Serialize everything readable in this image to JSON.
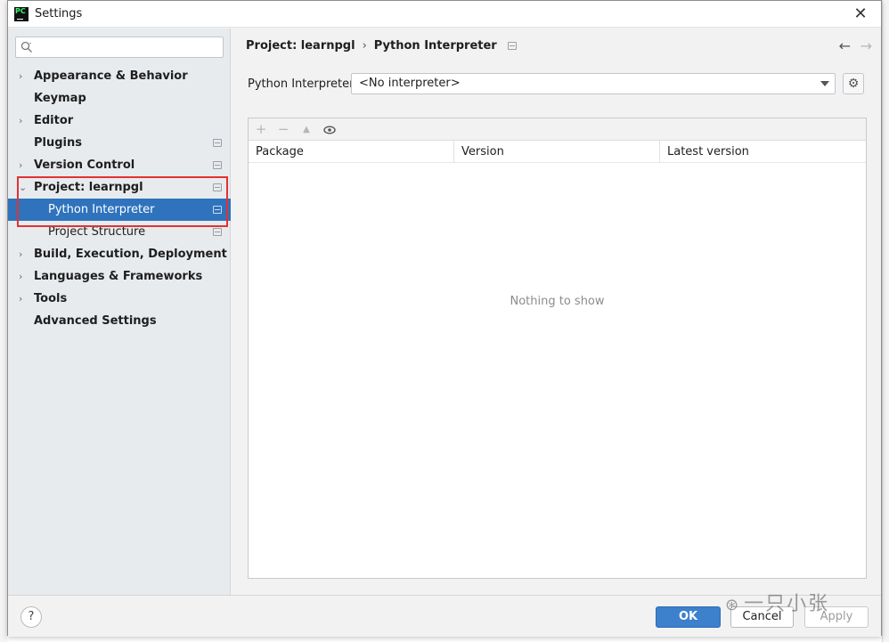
{
  "window": {
    "title": "Settings",
    "app_icon": "pycharm-logo"
  },
  "search": {
    "placeholder": ""
  },
  "sidebar": {
    "items": [
      {
        "label": "Appearance & Behavior",
        "expandable": true,
        "bold": true
      },
      {
        "label": "Keymap",
        "expandable": false,
        "bold": true
      },
      {
        "label": "Editor",
        "expandable": true,
        "bold": true
      },
      {
        "label": "Plugins",
        "expandable": false,
        "bold": true,
        "project_icon": true
      },
      {
        "label": "Version Control",
        "expandable": true,
        "bold": true,
        "project_icon": true
      },
      {
        "label": "Project: learnpgl",
        "expanded": true,
        "bold": true,
        "project_icon": true
      },
      {
        "label": "Python Interpreter",
        "child": true,
        "selected": true,
        "project_icon": true
      },
      {
        "label": "Project Structure",
        "child": true,
        "project_icon": true
      },
      {
        "label": "Build, Execution, Deployment",
        "expandable": true,
        "bold": true
      },
      {
        "label": "Languages & Frameworks",
        "expandable": true,
        "bold": true
      },
      {
        "label": "Tools",
        "expandable": true,
        "bold": true
      },
      {
        "label": "Advanced Settings",
        "expandable": false,
        "bold": true
      }
    ]
  },
  "breadcrumb": {
    "parent": "Project: learnpgl",
    "separator": "›",
    "current": "Python Interpreter"
  },
  "interpreter": {
    "label": "Python Interpreter:",
    "value": "<No interpreter>"
  },
  "packages": {
    "toolbar": {
      "add": "+",
      "remove": "−",
      "upgrade": "▲",
      "show": "👁"
    },
    "columns": [
      "Package",
      "Version",
      "Latest version"
    ],
    "empty_text": "Nothing to show"
  },
  "footer": {
    "help": "?",
    "ok": "OK",
    "cancel": "Cancel",
    "apply": "Apply"
  },
  "watermark": {
    "text": "一只小张"
  },
  "colors": {
    "selection": "#2f73bd",
    "ok_button": "#3d80cc",
    "highlight_box": "#e23232"
  }
}
